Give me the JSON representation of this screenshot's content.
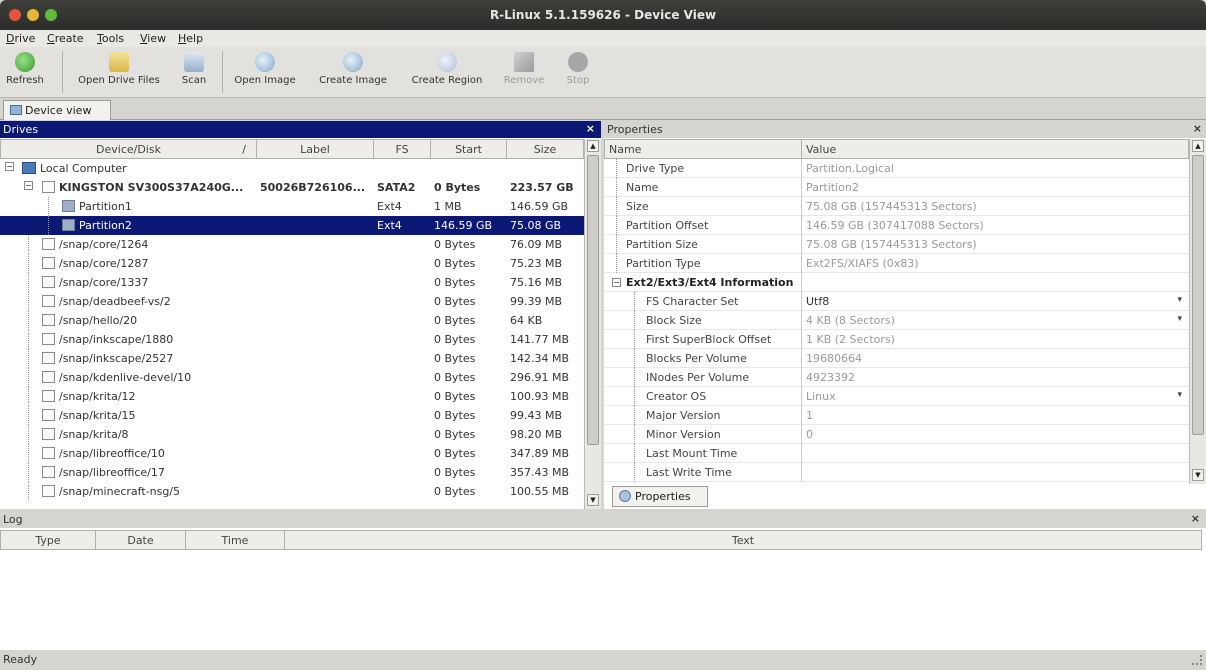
{
  "window": {
    "title": "R-Linux 5.1.159626 - Device View"
  },
  "menu": [
    {
      "label": "Drive",
      "u": "D"
    },
    {
      "label": "Create",
      "u": "C"
    },
    {
      "label": "Tools",
      "u": "T"
    },
    {
      "label": "View",
      "u": "V"
    },
    {
      "label": "Help",
      "u": "H"
    }
  ],
  "toolbar": {
    "refresh": "Refresh",
    "open_drive_files": "Open Drive Files",
    "scan": "Scan",
    "open_image": "Open Image",
    "create_image": "Create Image",
    "create_region": "Create Region",
    "remove": "Remove",
    "stop": "Stop"
  },
  "doc_tab": "Device view",
  "drives": {
    "title": "Drives",
    "columns": [
      "Device/Disk",
      "Label",
      "FS",
      "Start",
      "Size"
    ],
    "sort_indicator": "/",
    "rows": [
      {
        "name": "Local Computer",
        "label": "",
        "fs": "",
        "start": "",
        "size": "",
        "level": 0,
        "kind": "computer",
        "expander": "−"
      },
      {
        "name": "KINGSTON SV300S37A240G...",
        "label": "50026B726106...",
        "fs": "SATA2",
        "start": "0 Bytes",
        "size": "223.57 GB",
        "level": 1,
        "kind": "disk",
        "bold": true,
        "expander": "−"
      },
      {
        "name": "Partition1",
        "label": "",
        "fs": "Ext4",
        "start": "1 MB",
        "size": "146.59 GB",
        "level": 2,
        "kind": "partition"
      },
      {
        "name": "Partition2",
        "label": "",
        "fs": "Ext4",
        "start": "146.59 GB",
        "size": "75.08 GB",
        "level": 2,
        "kind": "partition",
        "selected": true
      },
      {
        "name": "/snap/core/1264",
        "label": "",
        "fs": "",
        "start": "0 Bytes",
        "size": "76.09 MB",
        "level": 1,
        "kind": "disk"
      },
      {
        "name": "/snap/core/1287",
        "label": "",
        "fs": "",
        "start": "0 Bytes",
        "size": "75.23 MB",
        "level": 1,
        "kind": "disk"
      },
      {
        "name": "/snap/core/1337",
        "label": "",
        "fs": "",
        "start": "0 Bytes",
        "size": "75.16 MB",
        "level": 1,
        "kind": "disk"
      },
      {
        "name": "/snap/deadbeef-vs/2",
        "label": "",
        "fs": "",
        "start": "0 Bytes",
        "size": "99.39 MB",
        "level": 1,
        "kind": "disk"
      },
      {
        "name": "/snap/hello/20",
        "label": "",
        "fs": "",
        "start": "0 Bytes",
        "size": "64 KB",
        "level": 1,
        "kind": "disk"
      },
      {
        "name": "/snap/inkscape/1880",
        "label": "",
        "fs": "",
        "start": "0 Bytes",
        "size": "141.77 MB",
        "level": 1,
        "kind": "disk"
      },
      {
        "name": "/snap/inkscape/2527",
        "label": "",
        "fs": "",
        "start": "0 Bytes",
        "size": "142.34 MB",
        "level": 1,
        "kind": "disk"
      },
      {
        "name": "/snap/kdenlive-devel/10",
        "label": "",
        "fs": "",
        "start": "0 Bytes",
        "size": "296.91 MB",
        "level": 1,
        "kind": "disk"
      },
      {
        "name": "/snap/krita/12",
        "label": "",
        "fs": "",
        "start": "0 Bytes",
        "size": "100.93 MB",
        "level": 1,
        "kind": "disk"
      },
      {
        "name": "/snap/krita/15",
        "label": "",
        "fs": "",
        "start": "0 Bytes",
        "size": "99.43 MB",
        "level": 1,
        "kind": "disk"
      },
      {
        "name": "/snap/krita/8",
        "label": "",
        "fs": "",
        "start": "0 Bytes",
        "size": "98.20 MB",
        "level": 1,
        "kind": "disk"
      },
      {
        "name": "/snap/libreoffice/10",
        "label": "",
        "fs": "",
        "start": "0 Bytes",
        "size": "347.89 MB",
        "level": 1,
        "kind": "disk"
      },
      {
        "name": "/snap/libreoffice/17",
        "label": "",
        "fs": "",
        "start": "0 Bytes",
        "size": "357.43 MB",
        "level": 1,
        "kind": "disk"
      },
      {
        "name": "/snap/minecraft-nsg/5",
        "label": "",
        "fs": "",
        "start": "0 Bytes",
        "size": "100.55 MB",
        "level": 1,
        "kind": "disk"
      }
    ]
  },
  "properties": {
    "title": "Properties",
    "columns": [
      "Name",
      "Value"
    ],
    "rows": [
      {
        "name": "Drive Type",
        "value": "Partition.Logical",
        "level": 1
      },
      {
        "name": "Name",
        "value": "Partition2",
        "level": 1
      },
      {
        "name": "Size",
        "value": "75.08 GB (157445313 Sectors)",
        "level": 1
      },
      {
        "name": "Partition Offset",
        "value": "146.59 GB (307417088 Sectors)",
        "level": 1
      },
      {
        "name": "Partition Size",
        "value": "75.08 GB (157445313 Sectors)",
        "level": 1
      },
      {
        "name": "Partition Type",
        "value": "Ext2FS/XIAFS (0x83)",
        "level": 1
      },
      {
        "name": "Ext2/Ext3/Ext4 Information",
        "value": "",
        "level": 0,
        "group": true
      },
      {
        "name": "FS Character Set",
        "value": "Utf8",
        "level": 2,
        "dropdown": true,
        "dark": true
      },
      {
        "name": "Block Size",
        "value": "4 KB (8 Sectors)",
        "level": 2,
        "dropdown": true
      },
      {
        "name": "First SuperBlock Offset",
        "value": "1 KB (2 Sectors)",
        "level": 2
      },
      {
        "name": "Blocks Per Volume",
        "value": "19680664",
        "level": 2
      },
      {
        "name": "INodes Per Volume",
        "value": "4923392",
        "level": 2
      },
      {
        "name": "Creator OS",
        "value": "Linux",
        "level": 2,
        "dropdown": true
      },
      {
        "name": "Major Version",
        "value": "1",
        "level": 2
      },
      {
        "name": "Minor Version",
        "value": "0",
        "level": 2
      },
      {
        "name": "Last Mount Time",
        "value": "",
        "level": 2
      },
      {
        "name": "Last Write Time",
        "value": "",
        "level": 2
      }
    ],
    "tab": "Properties",
    "dropdown_glyph": "▾",
    "group_expander": "−"
  },
  "log": {
    "title": "Log",
    "columns": [
      "Type",
      "Date",
      "Time",
      "Text"
    ]
  },
  "status": {
    "text": "Ready"
  },
  "colors": {
    "selection": "#0c1875",
    "panel_header": "#0c1875"
  }
}
